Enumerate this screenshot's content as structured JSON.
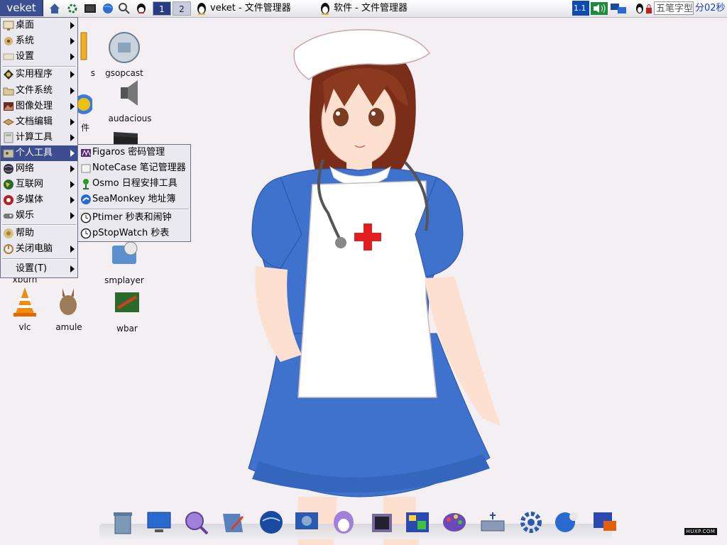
{
  "taskbar": {
    "start_label": "veket",
    "workspaces": [
      "1",
      "2"
    ],
    "tasks": [
      "veket - 文件管理器",
      "软件 - 文件管理器"
    ],
    "clock_partial": "1.1",
    "ime_label": "五笔字型",
    "timer_text": "分02秒"
  },
  "main_menu": {
    "items": [
      {
        "label": "桌面",
        "icon": "desktop-icon"
      },
      {
        "label": "系统",
        "icon": "system-icon"
      },
      {
        "label": "设置",
        "icon": "settings-icon"
      },
      {
        "label": "实用程序",
        "icon": "utilities-icon"
      },
      {
        "label": "文件系统",
        "icon": "filesystem-icon"
      },
      {
        "label": "图像处理",
        "icon": "graphics-icon"
      },
      {
        "label": "文档编辑",
        "icon": "document-icon"
      },
      {
        "label": "计算工具",
        "icon": "calculator-icon"
      },
      {
        "label": "个人工具",
        "icon": "personal-tools-icon"
      },
      {
        "label": "网络",
        "icon": "network-icon"
      },
      {
        "label": "互联网",
        "icon": "internet-icon"
      },
      {
        "label": "多媒体",
        "icon": "multimedia-icon"
      },
      {
        "label": "娱乐",
        "icon": "games-icon"
      },
      {
        "label": "帮助",
        "icon": "help-icon"
      },
      {
        "label": "关闭电脑",
        "icon": "shutdown-icon"
      },
      {
        "label": "设置(T)",
        "icon": ""
      }
    ]
  },
  "sub_menu": {
    "items": [
      {
        "label": "Figaros 密码管理",
        "icon": "password-manager-icon"
      },
      {
        "label": "NoteCase 笔记管理器",
        "icon": "notes-icon"
      },
      {
        "label": "Osmo 日程安排工具",
        "icon": "calendar-pin-icon"
      },
      {
        "label": "SeaMonkey 地址簿",
        "icon": "addressbook-icon"
      },
      {
        "label": "Ptimer 秒表和闹钟",
        "icon": "clock-icon"
      },
      {
        "label": "pStopWatch 秒表",
        "icon": "stopwatch-icon"
      }
    ]
  },
  "desktop_icons": [
    {
      "label": "s",
      "icon": "pencil-icon"
    },
    {
      "label": "gsopcast",
      "icon": "gsopcast-icon"
    },
    {
      "label": "件",
      "icon": "files-icon"
    },
    {
      "label": "audacious",
      "icon": "speaker-icon"
    },
    {
      "label": "smplayer",
      "icon": "smplayer-icon"
    },
    {
      "label": "xburn",
      "icon": "xburn-icon"
    },
    {
      "label": "vlc",
      "icon": "vlc-cone-icon"
    },
    {
      "label": "amule",
      "icon": "amule-mule-icon"
    },
    {
      "label": "wbar",
      "icon": "wbar-icon"
    }
  ],
  "watermark": "HUXP.COM",
  "colors": {
    "accent": "#3c4d92",
    "menu_bg": "#ebe9f0",
    "desktop_bg": "#f3eff3",
    "timer": "#1a3fc9"
  }
}
